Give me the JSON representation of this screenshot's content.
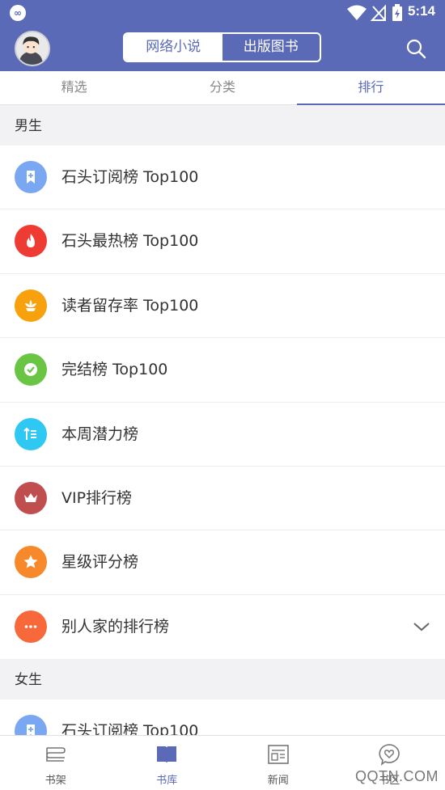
{
  "status_bar": {
    "time": "5:14"
  },
  "app_bar": {
    "segments": [
      {
        "label": "网络小说",
        "active": true
      },
      {
        "label": "出版图书",
        "active": false
      }
    ],
    "icons": {
      "avatar": "user-avatar",
      "search": "search-icon"
    }
  },
  "tabs": [
    {
      "label": "精选",
      "active": false
    },
    {
      "label": "分类",
      "active": false
    },
    {
      "label": "排行",
      "active": true
    }
  ],
  "sections": [
    {
      "title": "男生",
      "items": [
        {
          "label": "石头订阅榜 Top100",
          "icon": "bookmark-plus-icon",
          "color": "#7aa7f2"
        },
        {
          "label": "石头最热榜 Top100",
          "icon": "flame-icon",
          "color": "#ee3b33"
        },
        {
          "label": "读者留存率 Top100",
          "icon": "lotus-icon",
          "color": "#f7a10c"
        },
        {
          "label": "完结榜 Top100",
          "icon": "check-icon",
          "color": "#6bc544"
        },
        {
          "label": "本周潜力榜",
          "icon": "rising-list-icon",
          "color": "#2ec8f2"
        },
        {
          "label": "VIP排行榜",
          "icon": "crown-icon",
          "color": "#c14e4e"
        },
        {
          "label": "星级评分榜",
          "icon": "star-icon",
          "color": "#f7892a"
        },
        {
          "label": "别人家的排行榜",
          "icon": "more-dots-icon",
          "color": "#f7693a",
          "expandable": true
        }
      ]
    },
    {
      "title": "女生",
      "items": [
        {
          "label": "石头订阅榜 Top100",
          "icon": "bookmark-plus-icon",
          "color": "#7aa7f2"
        }
      ]
    }
  ],
  "bottom_nav": [
    {
      "label": "书架",
      "icon": "bookshelf-icon",
      "active": false
    },
    {
      "label": "书库",
      "icon": "open-book-icon",
      "active": true
    },
    {
      "label": "新闻",
      "icon": "newspaper-icon",
      "active": false
    },
    {
      "label": "书区",
      "icon": "heart-chat-icon",
      "active": false
    }
  ],
  "watermark": "QQTN.COM"
}
